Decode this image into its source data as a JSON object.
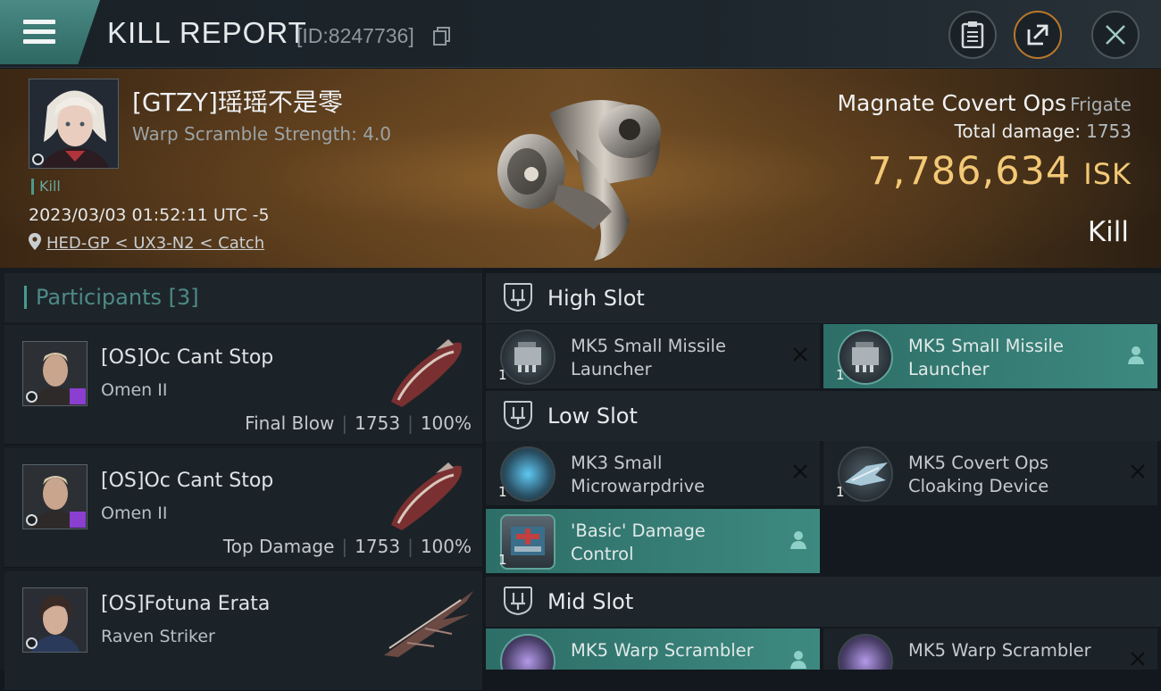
{
  "header": {
    "title": "KILL REPORT",
    "report_id": "[ID:8247736]"
  },
  "victim": {
    "name": "[GTZY]瑶瑶不是零",
    "warp_scramble": "Warp Scramble Strength: 4.0",
    "tag": "Kill",
    "datetime": "2023/03/03 01:52:11 UTC -5",
    "location": "HED-GP < UX3-N2 < Catch",
    "ship_name": "Magnate Covert Ops",
    "ship_class": "Frigate",
    "total_damage_label": "Total damage:",
    "total_damage": "1753",
    "isk_value": "7,786,634",
    "isk_unit": "ISK",
    "result": "Kill"
  },
  "participants": {
    "label": "Participants",
    "count": "[3]",
    "rows": [
      {
        "name": "[OS]Oc Cant Stop",
        "ship": "Omen II",
        "role": "Final Blow",
        "damage": "1753",
        "percent": "100%"
      },
      {
        "name": "[OS]Oc Cant Stop",
        "ship": "Omen II",
        "role": "Top Damage",
        "damage": "1753",
        "percent": "100%"
      },
      {
        "name": "[OS]Fotuna Erata",
        "ship": "Raven Striker"
      }
    ]
  },
  "fitting": {
    "high_slot": {
      "label": "High Slot",
      "modules": [
        {
          "name": "MK5 Small Missile Launcher",
          "qty": "1",
          "state": "destroyed"
        },
        {
          "name": "MK5 Small Missile Launcher",
          "qty": "1",
          "state": "dropped"
        }
      ]
    },
    "low_slot": {
      "label": "Low Slot",
      "modules": [
        {
          "name": "MK3 Small Microwarpdrive",
          "qty": "1",
          "state": "destroyed"
        },
        {
          "name": "MK5 Covert Ops Cloaking Device",
          "qty": "1",
          "state": "destroyed"
        },
        {
          "name": "'Basic' Damage Control",
          "qty": "1",
          "state": "dropped"
        }
      ]
    },
    "mid_slot": {
      "label": "Mid Slot",
      "modules": [
        {
          "name": "MK5 Warp Scrambler",
          "qty": "1",
          "state": "dropped"
        },
        {
          "name": "MK5 Warp Scrambler",
          "qty": "1",
          "state": "destroyed"
        }
      ]
    }
  },
  "colors": {
    "accent_teal": "#3d8980",
    "isk_gold": "#f3c876",
    "close_orange": "#b8772c"
  }
}
